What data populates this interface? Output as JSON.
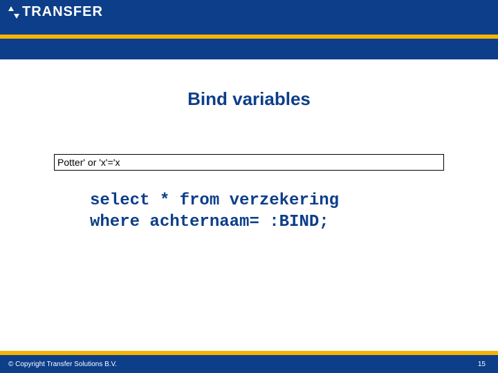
{
  "header": {
    "logo_text": "TRANSFER"
  },
  "content": {
    "title": "Bind variables",
    "input_value": "Potter' or 'x'='x",
    "code_line1": "select * from verzekering",
    "code_line2": "where achternaam= :BIND;"
  },
  "footer": {
    "copyright": "© Copyright Transfer Solutions B.V.",
    "page_number": "15"
  }
}
